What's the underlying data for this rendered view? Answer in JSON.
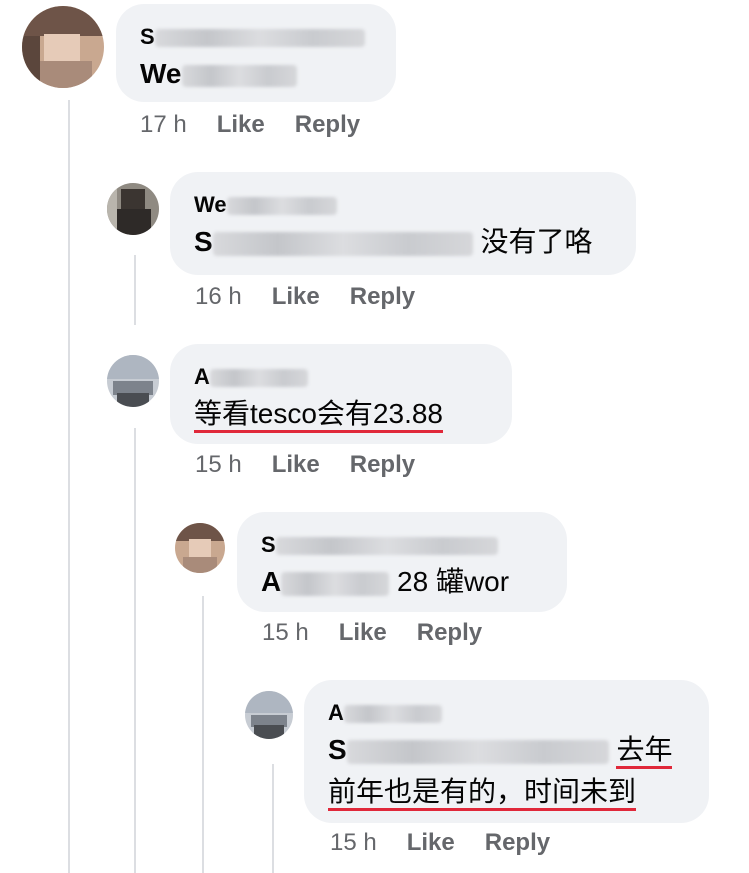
{
  "comments": [
    {
      "author": "S",
      "body_prefix": "We",
      "body_text": "",
      "time": "17 h",
      "like": "Like",
      "reply": "Reply"
    },
    {
      "author": "We",
      "mention": "S",
      "body_text": "没有了咯",
      "time": "16 h",
      "like": "Like",
      "reply": "Reply"
    },
    {
      "author": "A",
      "body_text": "等看tesco会有23.88",
      "time": "15 h",
      "like": "Like",
      "reply": "Reply"
    },
    {
      "author": "S",
      "mention": "A",
      "body_text": "28 罐wor",
      "time": "15 h",
      "like": "Like",
      "reply": "Reply"
    },
    {
      "author": "A",
      "mention": "S",
      "body_line1": "去年",
      "body_line2": "前年也是有的，时间未到",
      "time": "15 h",
      "like": "Like",
      "reply": "Reply"
    }
  ],
  "colors": {
    "bubble": "#f0f2f5",
    "meta": "#65676b",
    "underline": "#e0283a",
    "thread_line": "#dcdee2"
  }
}
